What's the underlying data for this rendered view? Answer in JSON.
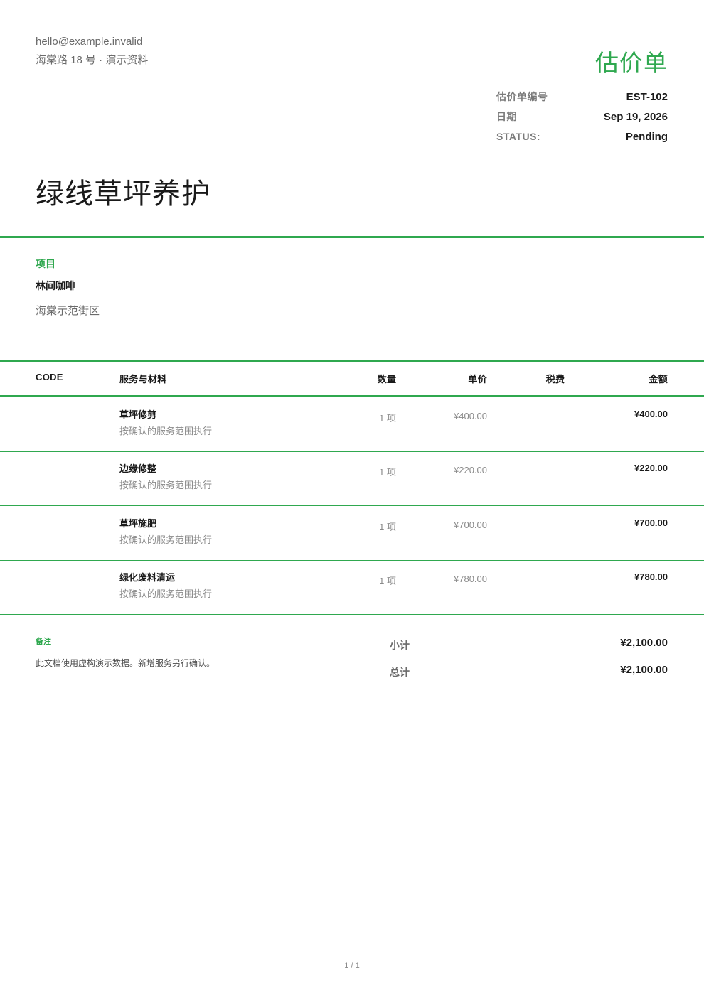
{
  "sender": {
    "email": "hello@example.invalid",
    "address": "海棠路 18 号 · 演示资料"
  },
  "document": {
    "type": "估价单",
    "meta": [
      {
        "label": "估价单编号",
        "value": "EST-102"
      },
      {
        "label": "日期",
        "value": "Sep 19, 2026"
      },
      {
        "label": "STATUS:",
        "value": "Pending"
      }
    ]
  },
  "company": "绿线草坪养护",
  "project": {
    "label": "项目",
    "name": "林间咖啡",
    "location": "海棠示范街区"
  },
  "table": {
    "headers": {
      "code": "CODE",
      "description": "服务与材料",
      "quantity": "数量",
      "unit_price": "单价",
      "tax": "税费",
      "amount": "金额"
    },
    "rows": [
      {
        "code": "",
        "name": "草坪修剪",
        "desc": "按确认的服务范围执行",
        "qty": "1 项",
        "unit": "¥400.00",
        "tax": "",
        "amount": "¥400.00"
      },
      {
        "code": "",
        "name": "边缘修整",
        "desc": "按确认的服务范围执行",
        "qty": "1 项",
        "unit": "¥220.00",
        "tax": "",
        "amount": "¥220.00"
      },
      {
        "code": "",
        "name": "草坪施肥",
        "desc": "按确认的服务范围执行",
        "qty": "1 项",
        "unit": "¥700.00",
        "tax": "",
        "amount": "¥700.00"
      },
      {
        "code": "",
        "name": "绿化废料清运",
        "desc": "按确认的服务范围执行",
        "qty": "1 项",
        "unit": "¥780.00",
        "tax": "",
        "amount": "¥780.00"
      }
    ]
  },
  "notes": {
    "label": "备注",
    "text": "此文档使用虚构演示数据。新增服务另行确认。"
  },
  "totals": [
    {
      "label": "小计",
      "value": "¥2,100.00"
    },
    {
      "label": "总计",
      "value": "¥2,100.00"
    }
  ],
  "footer": {
    "page": "1 / 1"
  },
  "colors": {
    "accent": "#2fa84f",
    "text": "#1a1a1a",
    "muted": "#6b6b6b"
  }
}
